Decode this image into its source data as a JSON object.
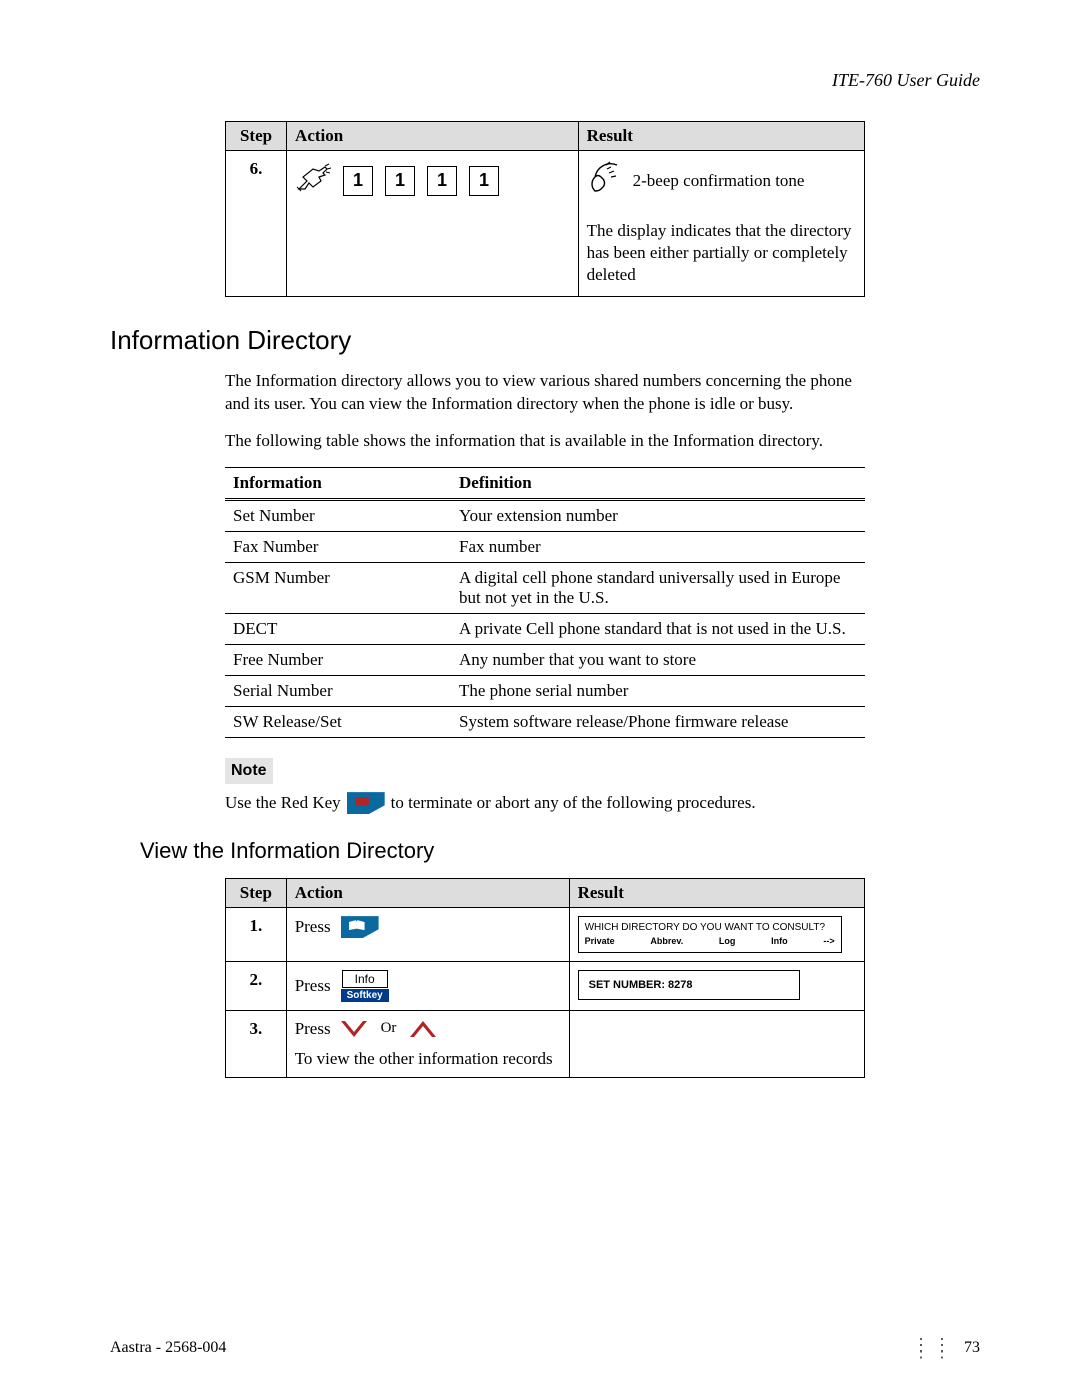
{
  "header": {
    "guide_title": "ITE-760 User Guide"
  },
  "top_table": {
    "col_step": "Step",
    "col_action": "Action",
    "col_result": "Result",
    "row": {
      "num": "6.",
      "digits": [
        "1",
        "1",
        "1",
        "1"
      ],
      "beep_text": "2-beep confirmation tone",
      "display_text": "The display indicates that the directory has been either partially or completely deleted"
    }
  },
  "section_info": {
    "heading": "Information Directory",
    "intro1": "The Information directory allows you to view various shared numbers concerning the phone and its user.  You can view the Information directory when the phone is idle or busy.",
    "intro2": "The following table shows the information that is available in the Information directory."
  },
  "info_table": {
    "col_info": "Information",
    "col_def": "Definition",
    "rows": [
      {
        "info": "Set Number",
        "def": "Your extension number"
      },
      {
        "info": "Fax Number",
        "def": "Fax number"
      },
      {
        "info": "GSM Number",
        "def": "A digital cell phone standard universally used in Europe but not yet in the U.S."
      },
      {
        "info": "DECT",
        "def": "A private Cell phone standard that is not used in the U.S."
      },
      {
        "info": "Free Number",
        "def": "Any number that you want to store"
      },
      {
        "info": "Serial Number",
        "def": "The phone serial number"
      },
      {
        "info": "SW Release/Set",
        "def": "System software release/Phone firmware release"
      }
    ]
  },
  "note": {
    "label": "Note",
    "before": "Use the Red Key",
    "after": "to terminate or abort any of the following procedures."
  },
  "view_section": {
    "heading": "View the Information Directory"
  },
  "view_table": {
    "col_step": "Step",
    "col_action": "Action",
    "col_result": "Result",
    "rows": {
      "r1": {
        "num": "1.",
        "press": "Press",
        "lcd_q": "WHICH DIRECTORY DO YOU WANT TO CONSULT?",
        "m1": "Private",
        "m2": "Abbrev.",
        "m3": "Log",
        "m4": "Info",
        "m5": "-->"
      },
      "r2": {
        "num": "2.",
        "press": "Press",
        "soft_cap": "Info",
        "soft_lab": "Softkey",
        "lcd": "SET NUMBER: 8278"
      },
      "r3": {
        "num": "3.",
        "press": "Press",
        "or": "Or",
        "sub": "To view the other information records"
      }
    }
  },
  "footer": {
    "left": "Aastra - 2568-004",
    "page": "73"
  }
}
